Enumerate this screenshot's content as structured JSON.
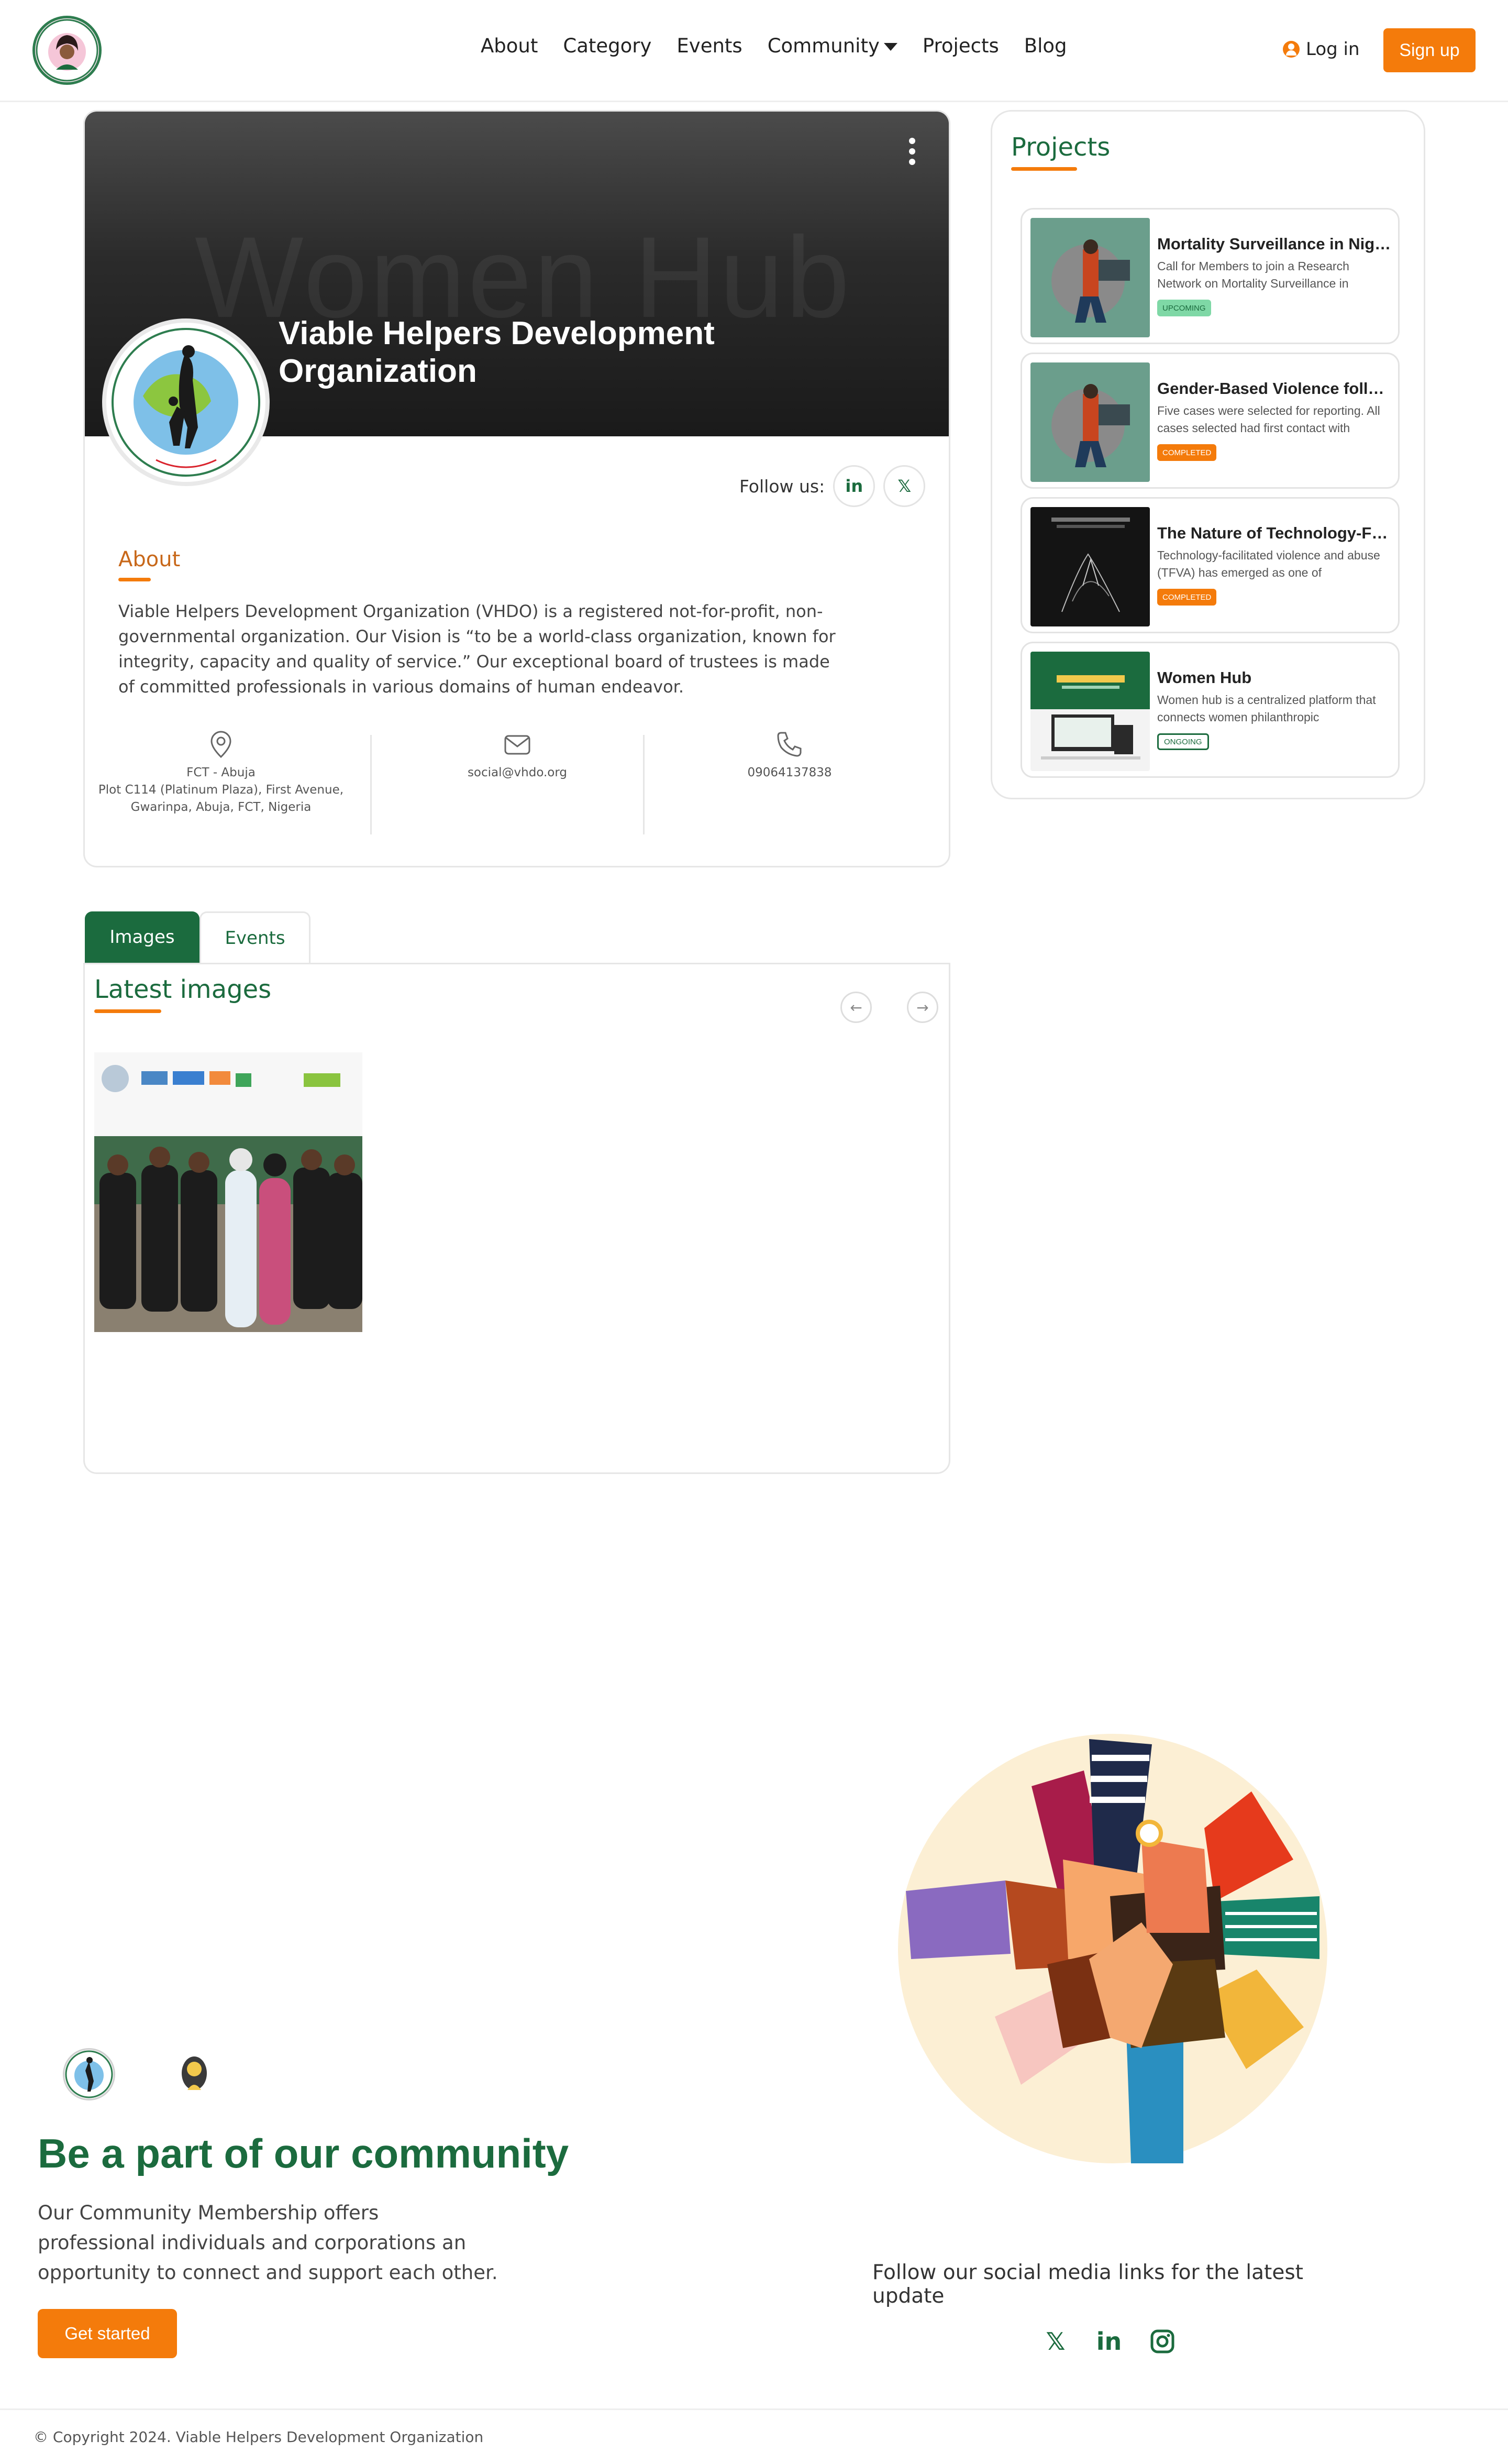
{
  "nav": {
    "links": [
      "About",
      "Category",
      "Events",
      "Community",
      "Projects",
      "Blog"
    ],
    "login": "Log in",
    "signup": "Sign up"
  },
  "profile": {
    "watermark": "Women Hub",
    "name": "Viable Helpers Development Organization",
    "follow_label": "Follow us:",
    "linkedin": "in",
    "x": "𝕏",
    "about_title": "About",
    "about_text": "Viable Helpers Development Organization (VHDO) is a registered not-for-profit, non-governmental organization. Our Vision is “to be a world-class organization, known for integrity, capacity and quality of service.” Our exceptional board of trustees is made of committed professionals in various domains of human endeavor.",
    "location_line1": "FCT - Abuja",
    "location_line2": "Plot C114 (Platinum Plaza), First Avenue,",
    "location_line3": "Gwarinpa, Abuja, FCT, Nigeria",
    "email": "social@vhdo.org",
    "phone": "09064137838"
  },
  "projects": {
    "title": "Projects",
    "items": [
      {
        "title": "Mortality Surveillance in Nigeria",
        "desc": "Call for Members to join a Research Network on Mortality Surveillance in",
        "status": "UPCOMING"
      },
      {
        "title": "Gender-Based Violence follow-up",
        "desc": "Five cases were selected for reporting. All cases selected had first contact with",
        "status": "COMPLETED"
      },
      {
        "title": "The Nature of Technology-Facilitated",
        "desc": "Technology-facilitated violence and abuse (TFVA) has emerged as one of",
        "status": "COMPLETED"
      },
      {
        "title": "Women Hub",
        "desc": "Women hub is a centralized platform that connects women philanthropic",
        "status": "ONGOING"
      }
    ]
  },
  "tabs": {
    "images": "Images",
    "events": "Events"
  },
  "gallery": {
    "title": "Latest images",
    "prev": "←",
    "next": "→"
  },
  "community": {
    "title": "Be a part of our community",
    "text": "Our Community Membership offers professional individuals and corporations an opportunity to connect and support each other.",
    "cta": "Get started",
    "follow_text": "Follow our social media links for the latest update",
    "social": [
      "𝕏",
      "in"
    ]
  },
  "footer": {
    "copyright": "© Copyright 2024. Viable Helpers Development Organization"
  },
  "colors": {
    "brand_green": "#1b6b3e",
    "accent_orange": "#f47b0b"
  }
}
